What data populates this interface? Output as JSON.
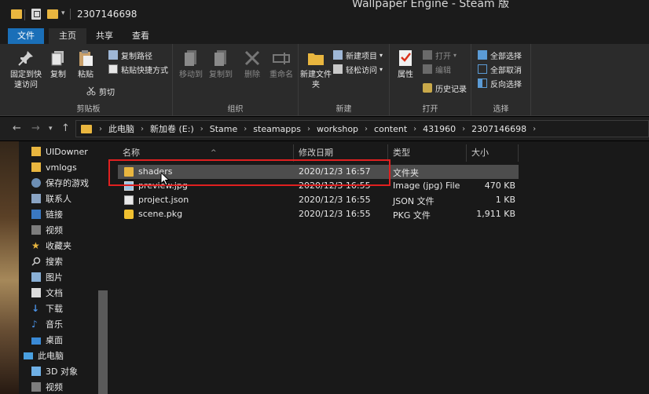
{
  "titlebar": {
    "title": "2307146698",
    "background_window_title": "Wallpaper Engine - Steam 版"
  },
  "tabs": [
    "文件",
    "主页",
    "共享",
    "查看"
  ],
  "ribbon": {
    "clipboard": {
      "pin_label": "固定到快速访问",
      "copy_label": "复制",
      "paste_label": "粘贴",
      "copy_path_label": "复制路径",
      "paste_shortcut_label": "粘贴快捷方式",
      "cut_label": "剪切",
      "group_label": "剪贴板"
    },
    "organize": {
      "move_to_label": "移动到",
      "copy_to_label": "复制到",
      "delete_label": "删除",
      "rename_label": "重命名",
      "group_label": "组织"
    },
    "new": {
      "new_folder_label": "新建文件夹",
      "new_item_label": "新建项目",
      "easy_access_label": "轻松访问",
      "group_label": "新建"
    },
    "open": {
      "properties_label": "属性",
      "open_label": "打开",
      "edit_label": "编辑",
      "history_label": "历史记录",
      "group_label": "打开"
    },
    "select": {
      "select_all_label": "全部选择",
      "select_none_label": "全部取消",
      "invert_label": "反向选择",
      "group_label": "选择"
    }
  },
  "address": {
    "crumbs": [
      "此电脑",
      "新加卷 (E:)",
      "Stame",
      "steamapps",
      "workshop",
      "content",
      "431960",
      "2307146698"
    ]
  },
  "sidebar": {
    "items": [
      {
        "label": "UIDowner",
        "icon": "folder-icon"
      },
      {
        "label": "vmlogs",
        "icon": "folder-icon"
      },
      {
        "label": "保存的游戏",
        "icon": "saved-games-icon"
      },
      {
        "label": "联系人",
        "icon": "contacts-icon"
      },
      {
        "label": "链接",
        "icon": "links-icon"
      },
      {
        "label": "视频",
        "icon": "videos-icon"
      },
      {
        "label": "收藏夹",
        "icon": "favorites-icon"
      },
      {
        "label": "搜索",
        "icon": "search-icon"
      },
      {
        "label": "图片",
        "icon": "pictures-icon"
      },
      {
        "label": "文档",
        "icon": "documents-icon"
      },
      {
        "label": "下载",
        "icon": "downloads-icon"
      },
      {
        "label": "音乐",
        "icon": "music-icon"
      },
      {
        "label": "桌面",
        "icon": "desktop-icon"
      },
      {
        "label": "此电脑",
        "icon": "this-pc-icon"
      },
      {
        "label": "3D 对象",
        "icon": "3d-objects-icon"
      },
      {
        "label": "视频",
        "icon": "videos-icon"
      }
    ]
  },
  "filelist": {
    "columns": [
      "名称",
      "修改日期",
      "类型",
      "大小"
    ],
    "rows": [
      {
        "name": "shaders",
        "date": "2020/12/3 16:57",
        "type": "文件夹",
        "size": "",
        "icon": "folder-icon"
      },
      {
        "name": "preview.jpg",
        "date": "2020/12/3 16:55",
        "type": "Image (jpg) File",
        "size": "470 KB",
        "icon": "image-file-icon"
      },
      {
        "name": "project.json",
        "date": "2020/12/3 16:55",
        "type": "JSON 文件",
        "size": "1 KB",
        "icon": "json-file-icon"
      },
      {
        "name": "scene.pkg",
        "date": "2020/12/3 16:55",
        "type": "PKG 文件",
        "size": "1,911 KB",
        "icon": "pkg-file-icon"
      }
    ]
  },
  "colors": {
    "accent": "#1a6fb8",
    "folder": "#e9b63f",
    "highlight_box": "#e02020"
  }
}
